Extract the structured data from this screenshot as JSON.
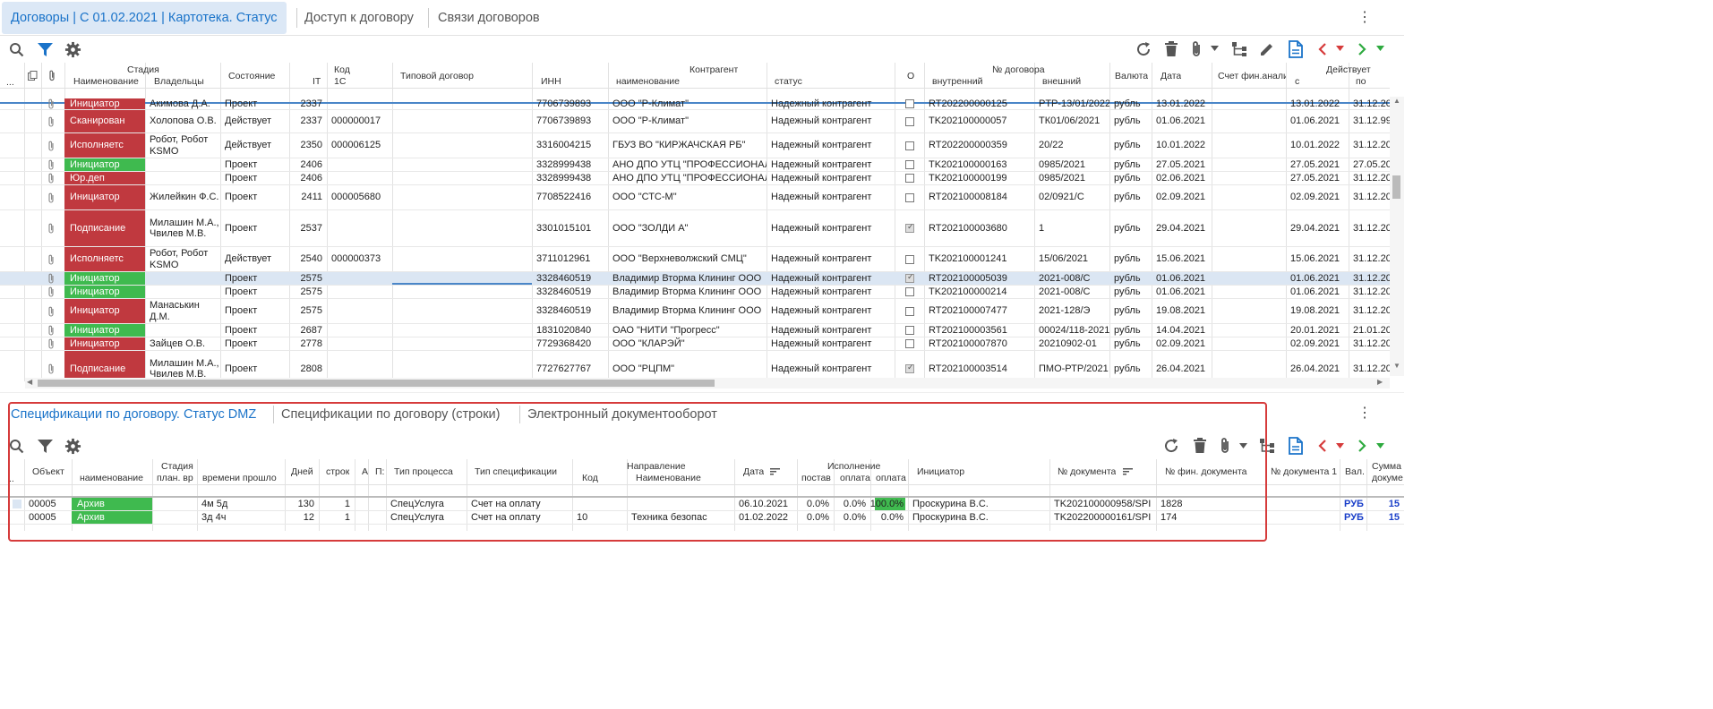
{
  "top_tabs": [
    {
      "label": "Договоры | С 01.02.2021 | Картотека. Статус",
      "active": true
    },
    {
      "label": "Доступ к договору",
      "active": false
    },
    {
      "label": "Связи договоров",
      "active": false
    }
  ],
  "top_grid": {
    "headers": {
      "stage_group": "Стадия",
      "stage_name": "Наименование",
      "owners": "Владельцы",
      "state": "Состояние",
      "code_group": "Код",
      "code_it": "IT",
      "code_1c": "1С",
      "typical": "Типовой договор",
      "counterparty_group": "Контрагент",
      "inn": "ИНН",
      "cp_name": "наименование",
      "cp_status": "статус",
      "o": "О",
      "contract_no_group": "№ договора",
      "internal": "внутренний",
      "external": "внешний",
      "currency": "Валюта",
      "date": "Дата",
      "fin_account": "Счет фин.анали",
      "valid_group": "Действует",
      "from": "с",
      "to": "по",
      "dots": "..."
    },
    "rows": [
      {
        "stage": "Инициатор",
        "stage_color": "red",
        "owners": "Акимова Д.А.",
        "state": "Проект",
        "it": "2337",
        "c1": "",
        "inn": "7706739893",
        "name": "ООО \"Р-Климат\"",
        "status": "Надежный контрагент",
        "o": false,
        "internal": "RT202200000125",
        "external": "PTP-13/01/2022",
        "currency": "рубль",
        "date": "13.01.2022",
        "from": "13.01.2022",
        "to": "31.12.20"
      },
      {
        "stage": "Сканирован",
        "stage_color": "red",
        "owners": "Холопова О.В.",
        "state": "Действует",
        "it": "2337",
        "c1": "000000017",
        "inn": "7706739893",
        "name": "ООО \"Р-Климат\"",
        "status": "Надежный контрагент",
        "o": false,
        "internal": "TK202100000057",
        "external": "ТК01/06/2021",
        "currency": "рубль",
        "date": "01.06.2021",
        "from": "01.06.2021",
        "to": "31.12.99"
      },
      {
        "stage": "Исполняетс",
        "stage_color": "red",
        "owners": "Робот, Робот KSMO",
        "state": "Действует",
        "it": "2350",
        "c1": "000006125",
        "inn": "3316004215",
        "name": "ГБУЗ ВО \"КИРЖАЧСКАЯ РБ\"",
        "status": "Надежный контрагент",
        "o": false,
        "internal": "RT202200000359",
        "external": "20/22",
        "currency": "рубль",
        "date": "10.01.2022",
        "from": "10.01.2022",
        "to": "31.12.20"
      },
      {
        "stage": "Инициатор",
        "stage_color": "green",
        "owners": "",
        "state": "Проект",
        "it": "2406",
        "c1": "",
        "inn": "3328999438",
        "name": "АНО ДПО УТЦ \"ПРОФЕССИОНАЛ",
        "status": "Надежный контрагент",
        "o": false,
        "internal": "TK202100000163",
        "external": "0985/2021",
        "currency": "рубль",
        "date": "27.05.2021",
        "from": "27.05.2021",
        "to": "27.05.20"
      },
      {
        "stage": "Юр.деп",
        "stage_color": "red",
        "owners": "",
        "state": "Проект",
        "it": "2406",
        "c1": "",
        "inn": "3328999438",
        "name": "АНО ДПО УТЦ \"ПРОФЕССИОНАЛ",
        "status": "Надежный контрагент",
        "o": false,
        "internal": "TK202100000199",
        "external": "0985/2021",
        "currency": "рубль",
        "date": "02.06.2021",
        "from": "27.05.2021",
        "to": "31.12.20"
      },
      {
        "stage": "Инициатор",
        "stage_color": "red",
        "owners": "Жилейкин Ф.С.",
        "state": "Проект",
        "it": "2411",
        "c1": "000005680",
        "inn": "7708522416",
        "name": "ООО \"СТС-М\"",
        "status": "Надежный контрагент",
        "o": false,
        "internal": "RT202100008184",
        "external": "02/0921/С",
        "currency": "рубль",
        "date": "02.09.2021",
        "from": "02.09.2021",
        "to": "31.12.20"
      },
      {
        "stage": "Подписание",
        "stage_color": "red",
        "owners": "Милашин М.А., Чвилев М.В.",
        "state": "Проект",
        "it": "2537",
        "c1": "",
        "inn": "3301015101",
        "name": "ООО \"ЗОЛДИ А\"",
        "status": "Надежный контрагент",
        "o": true,
        "internal": "RT202100003680",
        "external": "1",
        "currency": "рубль",
        "date": "29.04.2021",
        "from": "29.04.2021",
        "to": "31.12.20"
      },
      {
        "stage": "Исполняетс",
        "stage_color": "red",
        "owners": "Робот, Робот KSMO",
        "state": "Действует",
        "it": "2540",
        "c1": "000000373",
        "inn": "3711012961",
        "name": "ООО \"Верхневолжский СМЦ\"",
        "status": "Надежный контрагент",
        "o": false,
        "internal": "TK202100001241",
        "external": "15/06/2021",
        "currency": "рубль",
        "date": "15.06.2021",
        "from": "15.06.2021",
        "to": "31.12.20"
      },
      {
        "stage": "Инициатор",
        "stage_color": "green",
        "owners": "",
        "state": "Проект",
        "it": "2575",
        "c1": "",
        "inn": "3328460519",
        "name": "Владимир Вторма Клининг ООО",
        "status": "Надежный контрагент",
        "o": true,
        "internal": "RT202100005039",
        "external": "2021-008/С",
        "currency": "рубль",
        "date": "01.06.2021",
        "from": "01.06.2021",
        "to": "31.12.20",
        "selected": true
      },
      {
        "stage": "Инициатор",
        "stage_color": "green",
        "owners": "",
        "state": "Проект",
        "it": "2575",
        "c1": "",
        "inn": "3328460519",
        "name": "Владимир Вторма Клининг ООО",
        "status": "Надежный контрагент",
        "o": false,
        "internal": "TK202100000214",
        "external": "2021-008/С",
        "currency": "рубль",
        "date": "01.06.2021",
        "from": "01.06.2021",
        "to": "31.12.20"
      },
      {
        "stage": "Инициатор",
        "stage_color": "red",
        "owners": "Манаськин Д.М.",
        "state": "Проект",
        "it": "2575",
        "c1": "",
        "inn": "3328460519",
        "name": "Владимир Вторма Клининг ООО",
        "status": "Надежный контрагент",
        "o": false,
        "internal": "RT202100007477",
        "external": "2021-128/Э",
        "currency": "рубль",
        "date": "19.08.2021",
        "from": "19.08.2021",
        "to": "31.12.20"
      },
      {
        "stage": "Инициатор",
        "stage_color": "green",
        "owners": "",
        "state": "Проект",
        "it": "2687",
        "c1": "",
        "inn": "1831020840",
        "name": "ОАО \"НИТИ \"Прогресс\"",
        "status": "Надежный контрагент",
        "o": false,
        "internal": "RT202100003561",
        "external": "00024/118-2021",
        "currency": "рубль",
        "date": "14.04.2021",
        "from": "20.01.2021",
        "to": "21.01.20"
      },
      {
        "stage": "Инициатор",
        "stage_color": "red",
        "owners": "Зайцев О.В.",
        "state": "Проект",
        "it": "2778",
        "c1": "",
        "inn": "7729368420",
        "name": "ООО \"КЛАРЭЙ\"",
        "status": "Надежный контрагент",
        "o": false,
        "internal": "RT202100007870",
        "external": "20210902-01",
        "currency": "рубль",
        "date": "02.09.2021",
        "from": "02.09.2021",
        "to": "31.12.20"
      },
      {
        "stage": "Подписание",
        "stage_color": "red",
        "owners": "Милашин М.А., Чвилев М.В.",
        "state": "Проект",
        "it": "2808",
        "c1": "",
        "inn": "7727627767",
        "name": "ООО \"РЦПМ\"",
        "status": "Надежный контрагент",
        "o": true,
        "internal": "RT202100003514",
        "external": "ПМО-РТР/2021",
        "currency": "рубль",
        "date": "26.04.2021",
        "from": "26.04.2021",
        "to": "31.12.20"
      }
    ]
  },
  "bottom_tabs": [
    {
      "label": "Спецификации по договору. Статус DMZ",
      "active": true
    },
    {
      "label": "Спецификации по договору (строки)",
      "active": false
    },
    {
      "label": "Электронный документооборот",
      "active": false
    }
  ],
  "bottom_grid": {
    "headers": {
      "dots": "..",
      "object": "Объект",
      "stage_group": "Стадия",
      "stage_name": "наименование",
      "plan": "план. вр",
      "time_passed": "времени прошло",
      "days": "Дней",
      "rows": "строк",
      "a": "А",
      "p": "П:",
      "process_type": "Тип процесса",
      "spec_type": "Тип спецификации",
      "direction_group": "Направление",
      "dir_code": "Код",
      "dir_name": "Наименование",
      "date": "Дата",
      "exec_group": "Исполнение",
      "supply": "постав",
      "payment": "оплата",
      "payment2": "оплата",
      "initiator": "Инициатор",
      "doc_no": "№ документа",
      "fin_doc_no": "№ фин. документа",
      "doc_no_1": "№ документа 1",
      "cur": "Вал.",
      "sum": "Сумма докуме"
    },
    "rows": [
      {
        "object": "00005",
        "stage": "Архив",
        "time_passed": "4м 5д",
        "days": "130",
        "rows": "1",
        "process_type": "СпецУслуга",
        "spec_type": "Счет на оплату",
        "dir_code": "",
        "dir_name": "",
        "date": "06.10.2021",
        "supply": "0.0%",
        "payment": "0.0%",
        "payment2": "100.0%",
        "payment2_green": true,
        "initiator": "Проскурина В.С.",
        "doc_no": "TK202100000958/SPI",
        "fin_doc_no": "1828",
        "cur": "РУБ",
        "sum": "15"
      },
      {
        "object": "00005",
        "stage": "Архив",
        "time_passed": "3д 4ч",
        "days": "12",
        "rows": "1",
        "process_type": "СпецУслуга",
        "spec_type": "Счет на оплату",
        "dir_code": "10",
        "dir_name": "Техника безопас",
        "date": "01.02.2022",
        "supply": "0.0%",
        "payment": "0.0%",
        "payment2": "0.0%",
        "payment2_green": false,
        "initiator": "Проскурина В.С.",
        "doc_no": "TK202200000161/SPI",
        "fin_doc_no": "174",
        "cur": "РУБ",
        "sum": "15"
      }
    ]
  },
  "icons": {
    "search": "search-icon",
    "filter": "filter-icon",
    "settings": "gear-icon",
    "refresh": "refresh-icon",
    "delete": "trash-icon",
    "attach": "paperclip-icon",
    "hierarchy": "hierarchy-icon",
    "edit": "pencil-icon",
    "document": "document-icon",
    "prev": "chevron-left-icon",
    "next": "chevron-right-icon"
  },
  "colors": {
    "accent": "#1a73c9",
    "stage_red": "#c0393f",
    "stage_green": "#3fba4f",
    "nav_red": "#d63b3b",
    "nav_green": "#2eaa3f",
    "highlight_frame": "#d63b3b"
  }
}
